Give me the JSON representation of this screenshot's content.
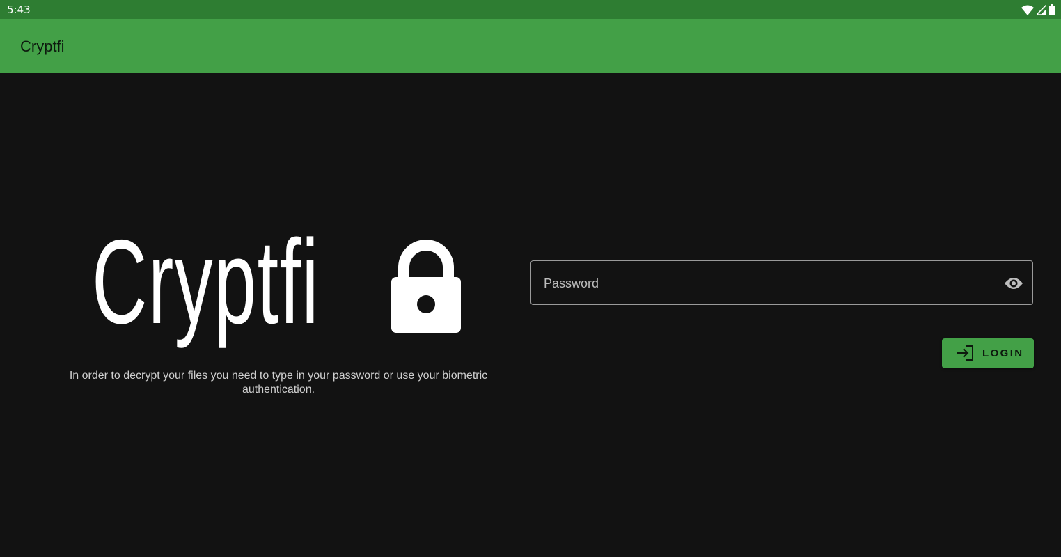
{
  "status_bar": {
    "time": "5:43",
    "icons": [
      "wifi-icon",
      "cell-signal-icon",
      "battery-icon"
    ]
  },
  "app_bar": {
    "title": "Cryptfi"
  },
  "logo": {
    "text": "Cryptfi",
    "icon": "lock-icon"
  },
  "description": "In order to decrypt your files you need to type in your password or use your biometric authentication.",
  "password_field": {
    "placeholder": "Password",
    "value": "",
    "toggle_icon": "eye-icon"
  },
  "login_button": {
    "label": "LOGIN",
    "icon": "login-icon"
  },
  "colors": {
    "status_bar": "#2e7d32",
    "app_bar": "#43a047",
    "background": "#121212",
    "accent": "#43a047"
  }
}
